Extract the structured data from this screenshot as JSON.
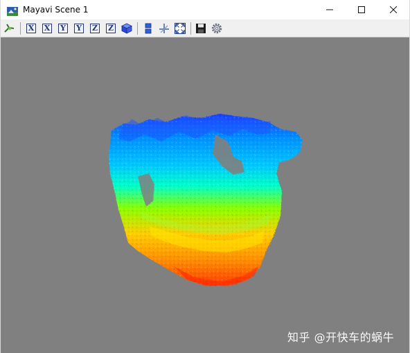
{
  "window": {
    "title": "Mayavi Scene 1",
    "controls": {
      "minimize": "—",
      "maximize": "☐",
      "close": "✕"
    }
  },
  "toolbar": {
    "buttons": [
      {
        "name": "mayavi-logo-icon"
      },
      {
        "name": "view-x-positive",
        "label": "X"
      },
      {
        "name": "view-x-negative",
        "label": "X"
      },
      {
        "name": "view-y-positive",
        "label": "Y"
      },
      {
        "name": "view-y-negative",
        "label": "Y"
      },
      {
        "name": "view-z-positive",
        "label": "Z"
      },
      {
        "name": "view-z-negative",
        "label": "Z"
      },
      {
        "name": "isometric-view-icon"
      },
      {
        "name": "parallel-projection-icon"
      },
      {
        "name": "axes-indicator-icon"
      },
      {
        "name": "full-screen-icon"
      },
      {
        "name": "save-icon"
      },
      {
        "name": "settings-gear-icon"
      }
    ]
  },
  "scene": {
    "background": "#808080",
    "colormap": [
      "#ff3a00",
      "#ffcc00",
      "#8aff00",
      "#00ffc8",
      "#0090ff",
      "#1c3cff"
    ]
  },
  "watermark": "知乎 @开快车的蜗牛"
}
